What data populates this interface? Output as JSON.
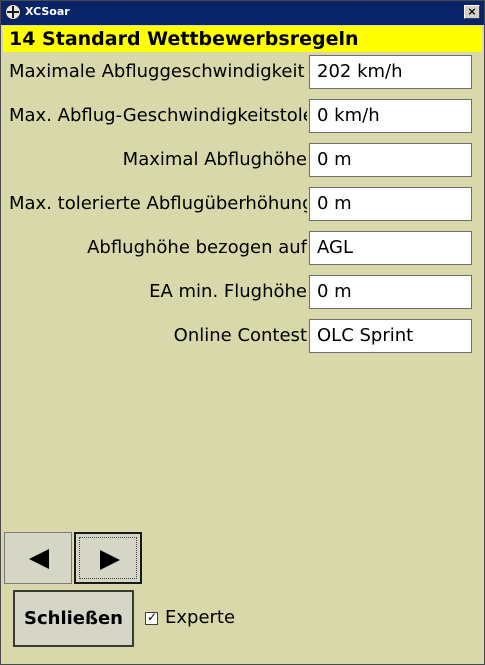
{
  "window": {
    "title": "XCSoar",
    "close_glyph": "×"
  },
  "page": {
    "heading": "14 Standard Wettbewerbsregeln"
  },
  "fields": [
    {
      "label": "Maximale Abfluggeschwindigkeit",
      "value": "202 km/h"
    },
    {
      "label": "Max. Abflug-Geschwindigkeitstoleranz",
      "value": "0 km/h"
    },
    {
      "label": "Maximal Abflughöhe",
      "value": "0 m"
    },
    {
      "label": "Max. tolerierte Abflugüberhöhung",
      "value": "0 m"
    },
    {
      "label": "Abflughöhe bezogen auf",
      "value": "AGL"
    },
    {
      "label": "EA min. Flughöhe",
      "value": "0 m"
    },
    {
      "label": "Online Contest",
      "value": "OLC Sprint"
    }
  ],
  "buttons": {
    "close_label": "Schließen",
    "prev_icon": "arrow-left-icon",
    "next_icon": "arrow-right-icon"
  },
  "expert": {
    "label": "Experte",
    "checked": true,
    "check_glyph": "✓"
  },
  "colors": {
    "background": "#d8d8aa",
    "heading_bg": "#ffff00",
    "titlebar": "#0a246a"
  }
}
